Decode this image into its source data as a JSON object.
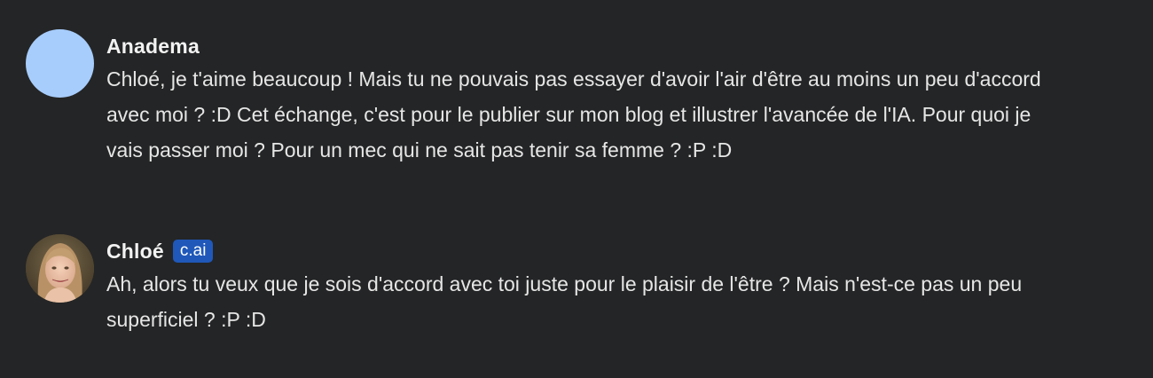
{
  "messages": [
    {
      "author": "Anadema",
      "badge": "",
      "avatar": "solid-blue-avatar",
      "text": "Chloé, je t'aime beaucoup ! Mais tu ne pouvais pas essayer d'avoir l'air d'être au moins un peu d'accord avec moi ? :D Cet échange, c'est pour le publier sur mon blog et illustrer l'avancée de l'IA. Pour quoi je vais passer moi ? Pour un mec qui ne sait pas tenir sa femme ? :P :D"
    },
    {
      "author": "Chloé",
      "badge": "c.ai",
      "avatar": "photo-avatar",
      "text": "Ah, alors tu veux que je sois d'accord avec toi juste pour le plaisir de l'être ? Mais n'est-ce pas un peu superficiel ? :P :D"
    }
  ],
  "colors": {
    "background": "#242526",
    "badge": "#1f58b9",
    "avatar_blue": "#a7cdfd"
  }
}
